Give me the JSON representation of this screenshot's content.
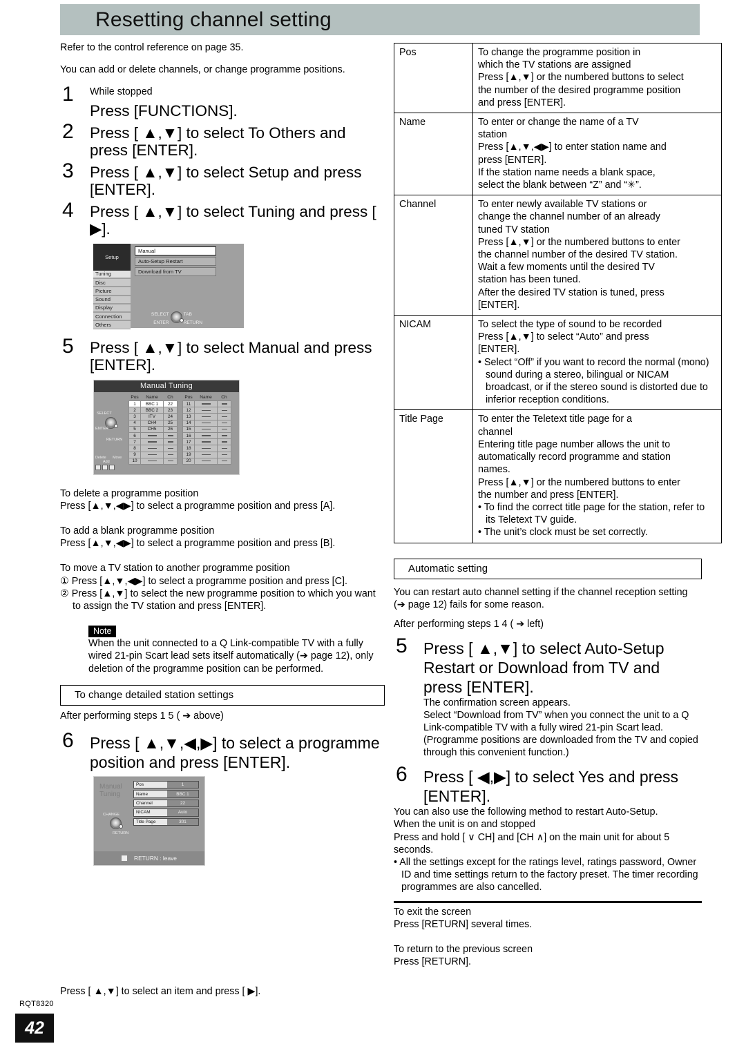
{
  "header": {
    "title": "Resetting channel setting"
  },
  "left": {
    "intro1": "Refer to the control reference on page 35.",
    "intro2": "You can add or delete channels, or change programme positions.",
    "steps": [
      {
        "num": "1",
        "pre": "While stopped",
        "text": "Press [FUNCTIONS]."
      },
      {
        "num": "2",
        "text": "Press [ ▲,▼] to select  To Others  and press [ENTER]."
      },
      {
        "num": "3",
        "text": "Press [ ▲,▼] to select  Setup  and press [ENTER]."
      },
      {
        "num": "4",
        "text": "Press [ ▲,▼] to select  Tuning  and press [ ▶]."
      },
      {
        "num": "5",
        "text": "Press [ ▲,▼] to select  Manual  and press [ENTER]."
      }
    ],
    "delete_head": "To delete a programme position",
    "delete_body": "Press [▲,▼,◀▶] to select a programme position and press [A].",
    "add_head": "To add a blank programme position",
    "add_body": "Press [▲,▼,◀▶] to select a programme position and press [B].",
    "move_head": "To move a TV station to another programme position",
    "move_1": "① Press [▲,▼,◀▶] to select a programme position and press [C].",
    "move_2": "② Press [▲,▼] to select the new programme position to which you want to assign the TV station and press [ENTER].",
    "note_label": "Note",
    "note_body": "When the unit connected to a Q Link-compatible TV with a fully wired 21-pin Scart lead sets itself automatically (➔ page 12), only deletion of the programme position can be performed.",
    "detailed_head": "To change detailed station settings",
    "after_steps": "After performing steps 1 5 (   ➔ above)",
    "step6": {
      "num": "6",
      "text": "Press [ ▲,▼,◀,▶] to select a programme position and press [ENTER]."
    },
    "footer_line": "Press [ ▲,▼] to select an item and press [   ▶]."
  },
  "osd_setup": {
    "title": "Setup",
    "menu": [
      "Tuning",
      "Disc",
      "Picture",
      "Sound",
      "Display",
      "Connection",
      "Others"
    ],
    "selected_menu": "Tuning",
    "options": [
      "Manual",
      "Auto-Setup Restart",
      "Download from TV"
    ],
    "selected_option": "Manual",
    "nav": {
      "select": "SELECT",
      "tab": "TAB",
      "enter": "ENTER",
      "return": "RETURN"
    }
  },
  "osd_manual_tuning": {
    "title": "Manual Tuning",
    "columns": [
      "Pos",
      "Name",
      "Ch"
    ],
    "rows_left": [
      {
        "pos": "1",
        "name": "BBC 1",
        "ch": "22"
      },
      {
        "pos": "2",
        "name": "BBC 2",
        "ch": "23"
      },
      {
        "pos": "3",
        "name": "ITV",
        "ch": "24"
      },
      {
        "pos": "4",
        "name": "CH4",
        "ch": "25"
      },
      {
        "pos": "5",
        "name": "CH5",
        "ch": "26"
      },
      {
        "pos": "6",
        "name": "",
        "ch": ""
      },
      {
        "pos": "7",
        "name": "",
        "ch": ""
      },
      {
        "pos": "8",
        "name": "",
        "ch": ""
      },
      {
        "pos": "9",
        "name": "",
        "ch": ""
      },
      {
        "pos": "10",
        "name": "",
        "ch": ""
      }
    ],
    "rows_right": [
      {
        "pos": "11",
        "name": "",
        "ch": ""
      },
      {
        "pos": "12",
        "name": "",
        "ch": ""
      },
      {
        "pos": "13",
        "name": "",
        "ch": ""
      },
      {
        "pos": "14",
        "name": "",
        "ch": ""
      },
      {
        "pos": "15",
        "name": "",
        "ch": ""
      },
      {
        "pos": "16",
        "name": "",
        "ch": ""
      },
      {
        "pos": "17",
        "name": "",
        "ch": ""
      },
      {
        "pos": "18",
        "name": "",
        "ch": ""
      },
      {
        "pos": "19",
        "name": "",
        "ch": ""
      },
      {
        "pos": "20",
        "name": "",
        "ch": ""
      }
    ],
    "nav": {
      "select": "SELECT",
      "enter": "ENTER",
      "return": "RETURN"
    },
    "keys": {
      "delete": "Delete",
      "add": "Add",
      "move": "Move"
    }
  },
  "osd_detail": {
    "title_line1": "Manual",
    "title_line2": "Tuning",
    "rows": [
      {
        "key": "Pos",
        "value": "1"
      },
      {
        "key": "Name",
        "value": "BBC 1"
      },
      {
        "key": "Channel",
        "value": "22"
      },
      {
        "key": "NICAM",
        "value": "Auto"
      },
      {
        "key": "Title Page",
        "value": "301"
      }
    ],
    "nav": {
      "change": "CHANGE",
      "return": "RETURN"
    },
    "bottom_bar": "RETURN : leave"
  },
  "spec_table": [
    {
      "key": "Pos",
      "lines": [
        "To change the programme position in",
        "which the TV stations are assigned",
        "Press [▲,▼] or the numbered buttons to select",
        "the number of the desired programme position",
        "and press [ENTER]."
      ]
    },
    {
      "key": "Name",
      "lines": [
        "To enter or change the name of a TV",
        "station",
        "Press [▲,▼,◀▶] to enter station name and",
        "press [ENTER].",
        "If the station name needs a blank space,",
        "select the blank between “Z” and “✳”."
      ]
    },
    {
      "key": "Channel",
      "lines": [
        "To enter newly available TV stations or",
        "change the channel number of an already",
        "tuned TV station",
        "Press [▲,▼] or the numbered buttons to enter",
        "the channel number of the desired TV station.",
        "Wait a few moments until the desired TV",
        "station has been tuned.",
        "After the desired TV station is tuned, press",
        "[ENTER]."
      ]
    },
    {
      "key": "NICAM",
      "lines": [
        "To select the type of sound to be recorded",
        "Press [▲,▼] to select “Auto” and press",
        "[ENTER]."
      ],
      "bullets": [
        "• Select “Off” if you want to record the normal (mono) sound during a stereo, bilingual or NICAM broadcast, or if the stereo sound is distorted due to inferior reception conditions."
      ]
    },
    {
      "key": "Title Page",
      "lines": [
        "To enter the Teletext title page for a",
        "channel",
        "Entering title page number allows the unit to",
        "automatically record programme and station",
        "names.",
        "Press [▲,▼] or the numbered buttons to enter",
        "the number and press [ENTER]."
      ],
      "bullets": [
        "• To find the correct title page for the station, refer to its Teletext TV guide.",
        "• The unit’s clock must be set correctly."
      ]
    }
  ],
  "right": {
    "auto_head": "Automatic setting",
    "auto_intro": "You can restart auto channel setting if the channel reception setting (➔ page 12) fails for some reason.",
    "after_steps": "After performing steps 1 4 (    ➔ left)",
    "step5": {
      "num": "5",
      "text": "Press [ ▲,▼] to select  Auto-Setup Restart  or  Download from TV  and press [ENTER]."
    },
    "step5_sub1": "The confirmation screen appears.",
    "step5_sub2": "Select “Download from TV” when you connect the unit to a Q Link-compatible TV with a fully wired 21-pin Scart lead. (Programme positions are downloaded from the TV and copied through this convenient function.)",
    "step6": {
      "num": "6",
      "text": "Press [ ◀,▶] to select  Yes  and press [ENTER]."
    },
    "alt1": "You can also use the following method to restart Auto-Setup.",
    "alt2": "When the unit is on and stopped",
    "alt3": "Press and hold [ ∨ CH] and [CH ∧] on the main unit for about 5 seconds.",
    "alt_bullet": "• All the settings except for the ratings level, ratings password, Owner ID and time settings return to the factory preset. The timer recording programmes are also cancelled.",
    "exit_head": "To exit the screen",
    "exit_body": "Press [RETURN] several times.",
    "return_head": "To return to the previous screen",
    "return_body": "Press [RETURN]."
  },
  "footer": {
    "code": "RQT8320",
    "page": "42"
  }
}
